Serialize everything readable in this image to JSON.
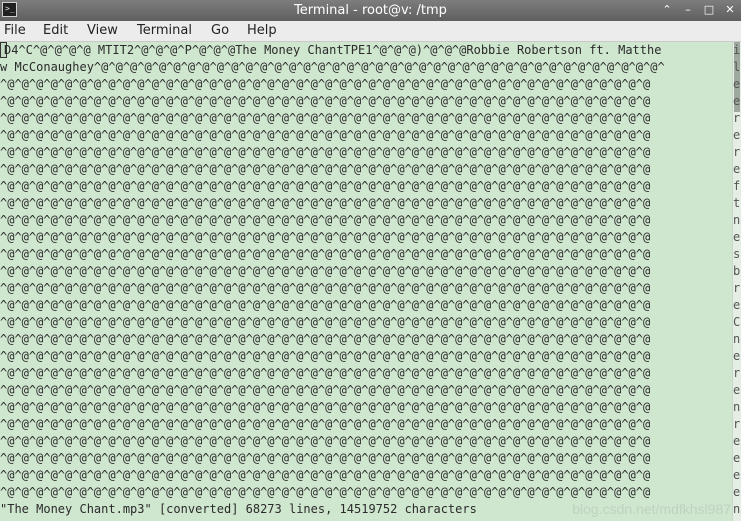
{
  "window": {
    "title": "Terminal - root@v: /tmp",
    "icon_text": ">_"
  },
  "controls": {
    "up": "⌃",
    "minimize": "–",
    "maximize": "□",
    "close": "✕"
  },
  "menu": [
    "File",
    "Edit",
    "View",
    "Terminal",
    "Go",
    "Help"
  ],
  "terminal": {
    "lines": [
      "D4^C^@^@^@^@ MTIT2^@^@^@^P^@^@^@The Money ChantTPE1^@^@^@)^@^@^@Robbie Robertson ft. Matthe",
      "w McConaughey^@^@^@^@^@^@^@^@^@^@^@^@^@^@^@^@^@^@^@^@^@^@^@^@^@^@^@^@^@^@^@^@^@^@^@^@^@^@^@^",
      "^@^@^@^@^@^@^@^@^@^@^@^@^@^@^@^@^@^@^@^@^@^@^@^@^@^@^@^@^@^@^@^@^@^@^@^@^@^@^@^@^@^@^@^@^@",
      "^@^@^@^@^@^@^@^@^@^@^@^@^@^@^@^@^@^@^@^@^@^@^@^@^@^@^@^@^@^@^@^@^@^@^@^@^@^@^@^@^@^@^@^@^@",
      "^@^@^@^@^@^@^@^@^@^@^@^@^@^@^@^@^@^@^@^@^@^@^@^@^@^@^@^@^@^@^@^@^@^@^@^@^@^@^@^@^@^@^@^@^@",
      "^@^@^@^@^@^@^@^@^@^@^@^@^@^@^@^@^@^@^@^@^@^@^@^@^@^@^@^@^@^@^@^@^@^@^@^@^@^@^@^@^@^@^@^@^@",
      "^@^@^@^@^@^@^@^@^@^@^@^@^@^@^@^@^@^@^@^@^@^@^@^@^@^@^@^@^@^@^@^@^@^@^@^@^@^@^@^@^@^@^@^@^@",
      "^@^@^@^@^@^@^@^@^@^@^@^@^@^@^@^@^@^@^@^@^@^@^@^@^@^@^@^@^@^@^@^@^@^@^@^@^@^@^@^@^@^@^@^@^@",
      "^@^@^@^@^@^@^@^@^@^@^@^@^@^@^@^@^@^@^@^@^@^@^@^@^@^@^@^@^@^@^@^@^@^@^@^@^@^@^@^@^@^@^@^@^@",
      "^@^@^@^@^@^@^@^@^@^@^@^@^@^@^@^@^@^@^@^@^@^@^@^@^@^@^@^@^@^@^@^@^@^@^@^@^@^@^@^@^@^@^@^@^@",
      "^@^@^@^@^@^@^@^@^@^@^@^@^@^@^@^@^@^@^@^@^@^@^@^@^@^@^@^@^@^@^@^@^@^@^@^@^@^@^@^@^@^@^@^@^@",
      "^@^@^@^@^@^@^@^@^@^@^@^@^@^@^@^@^@^@^@^@^@^@^@^@^@^@^@^@^@^@^@^@^@^@^@^@^@^@^@^@^@^@^@^@^@",
      "^@^@^@^@^@^@^@^@^@^@^@^@^@^@^@^@^@^@^@^@^@^@^@^@^@^@^@^@^@^@^@^@^@^@^@^@^@^@^@^@^@^@^@^@^@",
      "^@^@^@^@^@^@^@^@^@^@^@^@^@^@^@^@^@^@^@^@^@^@^@^@^@^@^@^@^@^@^@^@^@^@^@^@^@^@^@^@^@^@^@^@^@",
      "^@^@^@^@^@^@^@^@^@^@^@^@^@^@^@^@^@^@^@^@^@^@^@^@^@^@^@^@^@^@^@^@^@^@^@^@^@^@^@^@^@^@^@^@^@",
      "^@^@^@^@^@^@^@^@^@^@^@^@^@^@^@^@^@^@^@^@^@^@^@^@^@^@^@^@^@^@^@^@^@^@^@^@^@^@^@^@^@^@^@^@^@",
      "^@^@^@^@^@^@^@^@^@^@^@^@^@^@^@^@^@^@^@^@^@^@^@^@^@^@^@^@^@^@^@^@^@^@^@^@^@^@^@^@^@^@^@^@^@",
      "^@^@^@^@^@^@^@^@^@^@^@^@^@^@^@^@^@^@^@^@^@^@^@^@^@^@^@^@^@^@^@^@^@^@^@^@^@^@^@^@^@^@^@^@^@",
      "^@^@^@^@^@^@^@^@^@^@^@^@^@^@^@^@^@^@^@^@^@^@^@^@^@^@^@^@^@^@^@^@^@^@^@^@^@^@^@^@^@^@^@^@^@",
      "^@^@^@^@^@^@^@^@^@^@^@^@^@^@^@^@^@^@^@^@^@^@^@^@^@^@^@^@^@^@^@^@^@^@^@^@^@^@^@^@^@^@^@^@^@",
      "^@^@^@^@^@^@^@^@^@^@^@^@^@^@^@^@^@^@^@^@^@^@^@^@^@^@^@^@^@^@^@^@^@^@^@^@^@^@^@^@^@^@^@^@^@",
      "^@^@^@^@^@^@^@^@^@^@^@^@^@^@^@^@^@^@^@^@^@^@^@^@^@^@^@^@^@^@^@^@^@^@^@^@^@^@^@^@^@^@^@^@^@",
      "^@^@^@^@^@^@^@^@^@^@^@^@^@^@^@^@^@^@^@^@^@^@^@^@^@^@^@^@^@^@^@^@^@^@^@^@^@^@^@^@^@^@^@^@^@",
      "^@^@^@^@^@^@^@^@^@^@^@^@^@^@^@^@^@^@^@^@^@^@^@^@^@^@^@^@^@^@^@^@^@^@^@^@^@^@^@^@^@^@^@^@^@",
      "^@^@^@^@^@^@^@^@^@^@^@^@^@^@^@^@^@^@^@^@^@^@^@^@^@^@^@^@^@^@^@^@^@^@^@^@^@^@^@^@^@^@^@^@^@",
      "^@^@^@^@^@^@^@^@^@^@^@^@^@^@^@^@^@^@^@^@^@^@^@^@^@^@^@^@^@^@^@^@^@^@^@^@^@^@^@^@^@^@^@^@^@",
      "^@^@^@^@^@^@^@^@^@^@^@^@^@^@^@^@^@^@^@^@^@^@^@^@^@^@^@^@^@^@^@^@^@^@^@^@^@^@^@^@^@^@^@^@^@",
      "\"The Money Chant.mp3\" [converted] 68273 lines, 14519752 characters"
    ],
    "edge_chars": [
      "i",
      "l",
      "e",
      "e",
      "r",
      "e",
      "r",
      "e",
      "f",
      "t",
      "n",
      "e",
      "s",
      "b",
      "r",
      "e",
      "C",
      "n",
      "e",
      "r",
      "e",
      "n",
      "r",
      "e",
      "e",
      "e",
      "e",
      "n"
    ]
  },
  "watermark": "blog.csdn.net/mdfkhsl987"
}
